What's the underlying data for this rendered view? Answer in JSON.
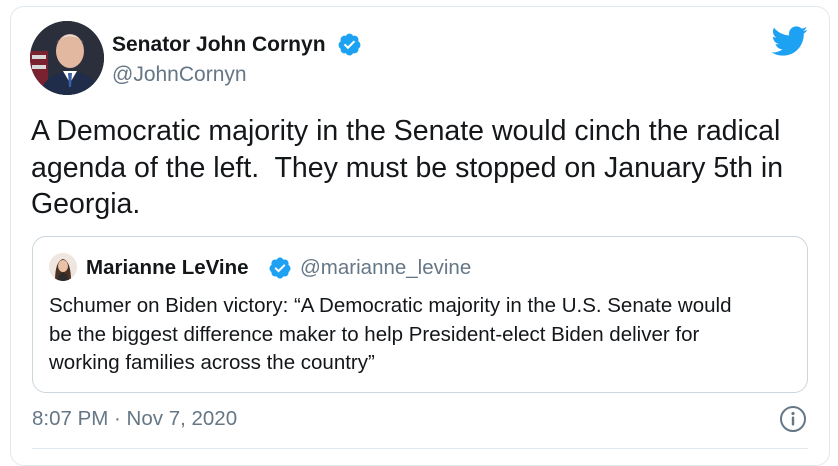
{
  "author": {
    "display_name": "Senator John Cornyn",
    "handle": "@JohnCornyn",
    "verified": true
  },
  "tweet": {
    "text": "A Democratic majority in the Senate would cinch the radical\nagenda of the left.  They must be stopped on January 5th in\nGeorgia.",
    "timestamp": "8:07 PM · Nov 7, 2020"
  },
  "quoted_tweet": {
    "display_name": "Marianne LeVine",
    "handle": "@marianne_levine",
    "verified": true,
    "text": "Schumer on Biden victory: “A Democratic majority in the U.S. Senate would\nbe the biggest difference maker to help President-elect Biden deliver for\nworking families across the country”"
  },
  "icons": {
    "brand": "twitter-bird-icon",
    "verified": "verified-badge-icon",
    "info": "info-icon"
  },
  "colors": {
    "twitter_blue": "#1da1f2",
    "text_primary": "#14171a",
    "text_secondary": "#657786",
    "border": "#e1e8ed"
  }
}
